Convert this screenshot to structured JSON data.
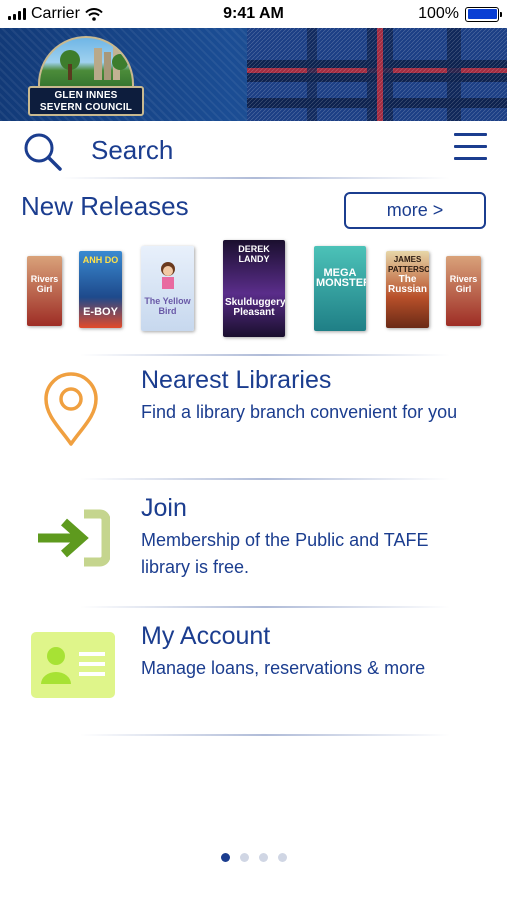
{
  "status_bar": {
    "carrier": "Carrier",
    "time": "9:41 AM",
    "battery": "100%"
  },
  "header": {
    "logo_line1": "GLEN INNES",
    "logo_line2": "SEVERN COUNCIL"
  },
  "search": {
    "label": "Search"
  },
  "new_releases": {
    "title": "New Releases",
    "more_label": "more >",
    "books": [
      {
        "cover_text": "Rivers Girl",
        "color": "#b33a2c"
      },
      {
        "cover_text": "E-BOY",
        "color": "#2b5fa8",
        "author": "ANH DO"
      },
      {
        "cover_text": "The Yellow Bird",
        "color": "#c7d8ee"
      },
      {
        "cover_text": "Skulduggery Pleasant",
        "color": "#3a1f5c",
        "author": "DEREK LANDY"
      },
      {
        "cover_text": "MEGA MONSTER",
        "color": "#2fa59a"
      },
      {
        "cover_text": "The Russian",
        "color": "#7a3a22",
        "author": "JAMES PATTERSON"
      },
      {
        "cover_text": "Rivers Girl",
        "color": "#b33a2c"
      }
    ]
  },
  "menu": {
    "nearest": {
      "title": "Nearest Libraries",
      "desc": "Find a library branch convenient for you"
    },
    "join": {
      "title": "Join",
      "desc": "Membership of the Public and TAFE library is free."
    },
    "account": {
      "title": "My Account",
      "desc": "Manage loans, reservations & more"
    }
  },
  "pagination": {
    "current_page": 1,
    "total_pages": 4
  },
  "colors": {
    "primary": "#1b3d8f",
    "pin_orange": "#f0a040",
    "join_green": "#5e9a1e",
    "account_green": "#dff58a"
  }
}
